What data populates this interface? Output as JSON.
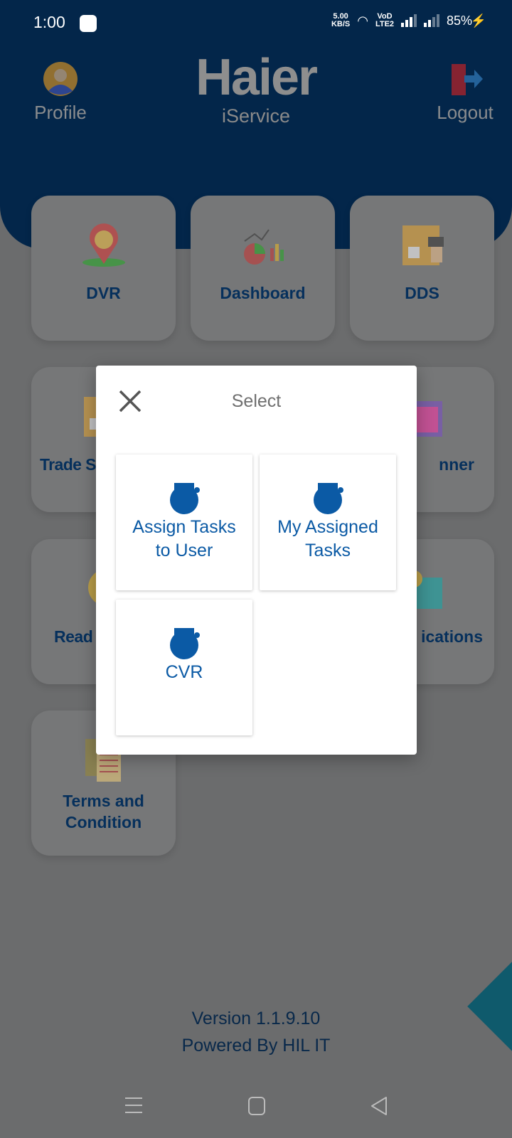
{
  "status_bar": {
    "time": "1:00",
    "net_speed": "5.00",
    "net_unit": "KB/S",
    "volte": "VoD LTE2",
    "battery": "85%"
  },
  "header": {
    "profile_label": "Profile",
    "logo": "Haier",
    "app_name": "iService",
    "logout_label": "Logout",
    "color": "#0756a8"
  },
  "tiles": [
    {
      "label": "DVR",
      "icon": "location-pin-icon"
    },
    {
      "label": "Dashboard",
      "icon": "analytics-chart-icon"
    },
    {
      "label": "DDS",
      "icon": "package-scanner-icon"
    },
    {
      "label": "Trade S",
      "icon": "package-icon"
    },
    {
      "label": "nner",
      "icon": "calendar-planner-icon"
    },
    {
      "label": "Read",
      "icon": "chat-bubble-icon"
    },
    {
      "label": "ications",
      "icon": "notification-bell-icon"
    },
    {
      "label": "Terms and Condition",
      "icon": "document-icon"
    }
  ],
  "footer": {
    "version": "Version 1.1.9.10",
    "powered": "Powered By HIL IT"
  },
  "modal": {
    "title": "Select",
    "options": [
      {
        "label": "Assign Tasks to User",
        "icon": "task-badge-icon"
      },
      {
        "label": "My Assigned Tasks",
        "icon": "task-badge-icon"
      },
      {
        "label": "CVR",
        "icon": "task-badge-icon"
      }
    ],
    "accent": "#0b5aa5"
  }
}
